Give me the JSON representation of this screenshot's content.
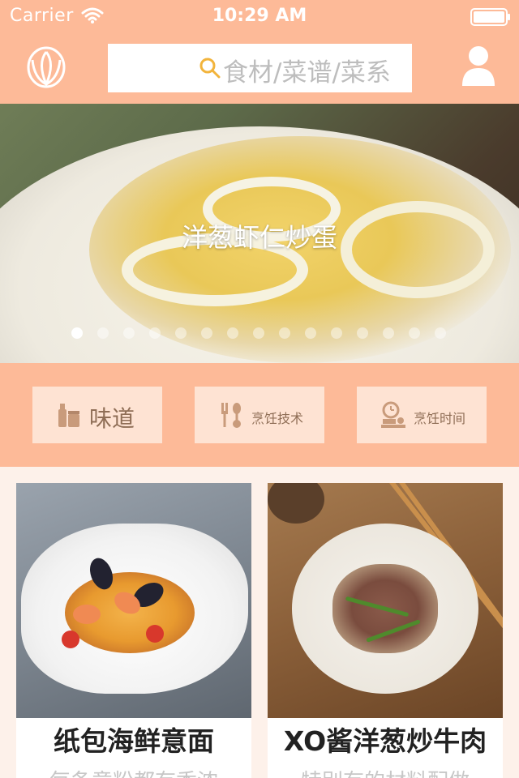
{
  "status_bar": {
    "carrier": "Carrier",
    "time": "10:29 AM"
  },
  "header": {
    "search_placeholder": "食材/菜谱/菜系"
  },
  "banner": {
    "title": "洋葱虾仁炒蛋",
    "dot_count": 15,
    "active_index": 0
  },
  "categories": [
    {
      "label": "味道",
      "icon": "condiment-bottles-icon"
    },
    {
      "label": "烹饪技术",
      "icon": "utensils-icon"
    },
    {
      "label": "烹饪时间",
      "icon": "kitchen-timer-icon"
    }
  ],
  "cards": [
    {
      "title": "纸包海鲜意面",
      "desc": "每条意粉都有香浓"
    },
    {
      "title": "XO酱洋葱炒牛肉",
      "desc": "特别有的材料配做"
    }
  ],
  "colors": {
    "accent": "#FDBA98",
    "button_bg": "#FEE3D3",
    "button_text": "#8F6E56",
    "search_icon": "#F2B43C"
  }
}
